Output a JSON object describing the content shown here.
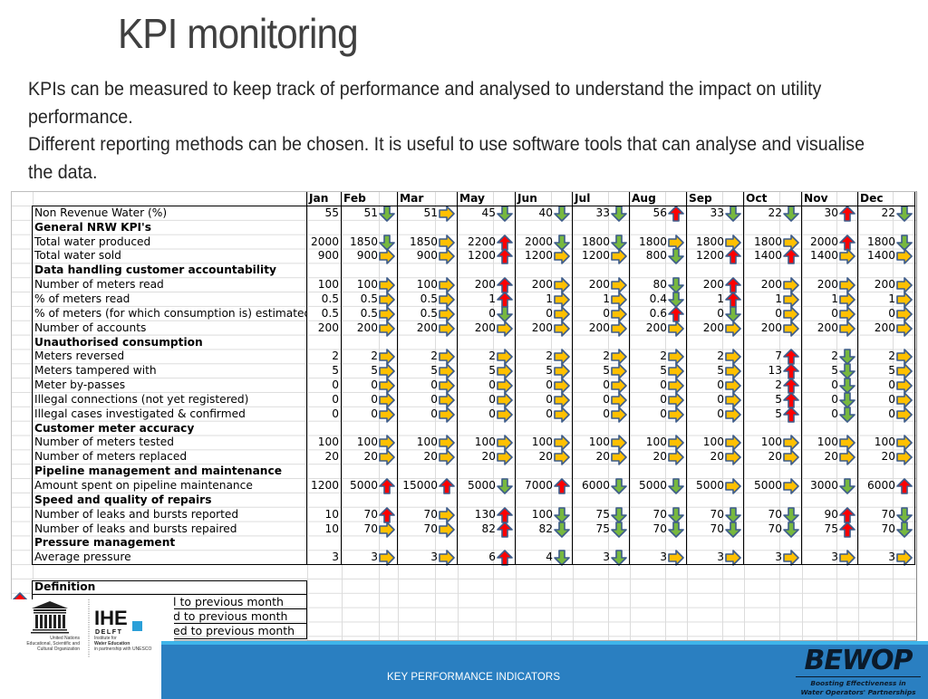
{
  "slide": {
    "title": "KPI monitoring",
    "intro": [
      "KPIs can be measured to keep track of performance and analysed to understand the impact on utility performance.",
      "Different reporting methods can be chosen. It is useful to use software tools that can analyse and visualise the data."
    ],
    "footer_label": "KEY PERFORMANCE INDICATORS"
  },
  "logos": {
    "unesco": {
      "name": "UNESCO",
      "caption": [
        "United Nations",
        "Educational, Scientific and",
        "Cultural Organization"
      ]
    },
    "ihe": {
      "name": "IHE",
      "sub": "DELFT",
      "caption": [
        "Institute for",
        "Water Education",
        "in partnership with UNESCO"
      ]
    },
    "bewop": {
      "name": "BEWOP",
      "tagline": [
        "Boosting Effectiveness in",
        "Water Operators' Partnerships"
      ]
    }
  },
  "colors": {
    "arrow_up": "#ff0000",
    "arrow_down": "#77b83f",
    "arrow_same": "#ffc000",
    "arrow_outline": "#3d5c8a",
    "footer_blue": "#2a7fc1",
    "footer_stripe": "#3fb5ea"
  },
  "kpi_table": {
    "months": [
      "Jan",
      "Feb",
      "Mar",
      "May",
      "Jun",
      "Jul",
      "Aug",
      "Sep",
      "Oct",
      "Nov",
      "Dec"
    ],
    "rows": [
      {
        "type": "kpi",
        "label": "Non Revenue Water (%)",
        "values": [
          "55",
          "51",
          "51",
          "45",
          "40",
          "33",
          "56",
          "33",
          "22",
          "30",
          "22"
        ],
        "trend": [
          "",
          "down",
          "same",
          "down",
          "down",
          "down",
          "up",
          "down",
          "down",
          "up",
          "down"
        ]
      },
      {
        "type": "section",
        "label": "General NRW KPI's"
      },
      {
        "type": "kpi",
        "label": "Total water produced",
        "values": [
          "2000",
          "1850",
          "1850",
          "2200",
          "2000",
          "1800",
          "1800",
          "1800",
          "1800",
          "2000",
          "1800"
        ],
        "trend": [
          "",
          "down",
          "same",
          "up",
          "down",
          "down",
          "same",
          "same",
          "same",
          "up",
          "down"
        ]
      },
      {
        "type": "kpi",
        "label": "Total water sold",
        "values": [
          "900",
          "900",
          "900",
          "1200",
          "1200",
          "1200",
          "800",
          "1200",
          "1400",
          "1400",
          "1400"
        ],
        "trend": [
          "",
          "same",
          "same",
          "up",
          "same",
          "same",
          "down",
          "up",
          "up",
          "same",
          "same"
        ]
      },
      {
        "type": "section",
        "label": "Data handling customer accountability"
      },
      {
        "type": "kpi",
        "label": "Number of meters read",
        "values": [
          "100",
          "100",
          "100",
          "200",
          "200",
          "200",
          "80",
          "200",
          "200",
          "200",
          "200"
        ],
        "trend": [
          "",
          "same",
          "same",
          "up",
          "same",
          "same",
          "down",
          "up",
          "same",
          "same",
          "same"
        ]
      },
      {
        "type": "kpi",
        "label": "% of meters read",
        "values": [
          "0.5",
          "0.5",
          "0.5",
          "1",
          "1",
          "1",
          "0.4",
          "1",
          "1",
          "1",
          "1"
        ],
        "trend": [
          "",
          "same",
          "same",
          "up",
          "same",
          "same",
          "down",
          "up",
          "same",
          "same",
          "same"
        ]
      },
      {
        "type": "kpi",
        "label": "% of meters (for which consumption is) estimated",
        "values": [
          "0.5",
          "0.5",
          "0.5",
          "0",
          "0",
          "0",
          "0.6",
          "0",
          "0",
          "0",
          "0"
        ],
        "trend": [
          "",
          "same",
          "same",
          "down",
          "same",
          "same",
          "up",
          "down",
          "same",
          "same",
          "same"
        ]
      },
      {
        "type": "kpi",
        "label": "Number of accounts",
        "values": [
          "200",
          "200",
          "200",
          "200",
          "200",
          "200",
          "200",
          "200",
          "200",
          "200",
          "200"
        ],
        "trend": [
          "",
          "same",
          "same",
          "same",
          "same",
          "same",
          "same",
          "same",
          "same",
          "same",
          "same"
        ]
      },
      {
        "type": "section",
        "label": "Unauthorised consumption"
      },
      {
        "type": "kpi",
        "label": "Meters reversed",
        "values": [
          "2",
          "2",
          "2",
          "2",
          "2",
          "2",
          "2",
          "2",
          "7",
          "2",
          "2"
        ],
        "trend": [
          "",
          "same",
          "same",
          "same",
          "same",
          "same",
          "same",
          "same",
          "up",
          "down",
          "same"
        ]
      },
      {
        "type": "kpi",
        "label": "Meters tampered with",
        "values": [
          "5",
          "5",
          "5",
          "5",
          "5",
          "5",
          "5",
          "5",
          "13",
          "5",
          "5"
        ],
        "trend": [
          "",
          "same",
          "same",
          "same",
          "same",
          "same",
          "same",
          "same",
          "up",
          "down",
          "same"
        ]
      },
      {
        "type": "kpi",
        "label": "Meter by-passes",
        "values": [
          "0",
          "0",
          "0",
          "0",
          "0",
          "0",
          "0",
          "0",
          "2",
          "0",
          "0"
        ],
        "trend": [
          "",
          "same",
          "same",
          "same",
          "same",
          "same",
          "same",
          "same",
          "up",
          "down",
          "same"
        ]
      },
      {
        "type": "kpi",
        "label": "Illegal connections (not yet registered)",
        "values": [
          "0",
          "0",
          "0",
          "0",
          "0",
          "0",
          "0",
          "0",
          "5",
          "0",
          "0"
        ],
        "trend": [
          "",
          "same",
          "same",
          "same",
          "same",
          "same",
          "same",
          "same",
          "up",
          "down",
          "same"
        ]
      },
      {
        "type": "kpi",
        "label": "Illegal cases investigated & confirmed",
        "values": [
          "0",
          "0",
          "0",
          "0",
          "0",
          "0",
          "0",
          "0",
          "5",
          "0",
          "0"
        ],
        "trend": [
          "",
          "same",
          "same",
          "same",
          "same",
          "same",
          "same",
          "same",
          "up",
          "down",
          "same"
        ]
      },
      {
        "type": "section",
        "label": "Customer meter accuracy"
      },
      {
        "type": "kpi",
        "label": "Number of meters tested",
        "values": [
          "100",
          "100",
          "100",
          "100",
          "100",
          "100",
          "100",
          "100",
          "100",
          "100",
          "100"
        ],
        "trend": [
          "",
          "same",
          "same",
          "same",
          "same",
          "same",
          "same",
          "same",
          "same",
          "same",
          "same"
        ]
      },
      {
        "type": "kpi",
        "label": "Number of meters replaced",
        "values": [
          "20",
          "20",
          "20",
          "20",
          "20",
          "20",
          "20",
          "20",
          "20",
          "20",
          "20"
        ],
        "trend": [
          "",
          "same",
          "same",
          "same",
          "same",
          "same",
          "same",
          "same",
          "same",
          "same",
          "same"
        ]
      },
      {
        "type": "section",
        "label": "Pipeline management and maintenance"
      },
      {
        "type": "kpi",
        "label": "Amount spent on pipeline maintenance",
        "values": [
          "1200",
          "5000",
          "15000",
          "5000",
          "7000",
          "6000",
          "5000",
          "5000",
          "5000",
          "3000",
          "6000"
        ],
        "trend": [
          "",
          "up",
          "up",
          "down",
          "up",
          "down",
          "down",
          "same",
          "same",
          "down",
          "up"
        ]
      },
      {
        "type": "section",
        "label": "Speed and quality of repairs"
      },
      {
        "type": "kpi",
        "label": "Number of leaks and bursts reported",
        "values": [
          "10",
          "70",
          "70",
          "130",
          "100",
          "75",
          "70",
          "70",
          "70",
          "90",
          "70"
        ],
        "trend": [
          "",
          "up",
          "same",
          "up",
          "down",
          "down",
          "down",
          "down",
          "down",
          "up",
          "down"
        ]
      },
      {
        "type": "kpi",
        "label": "Number of leaks and bursts repaired",
        "values": [
          "10",
          "70",
          "70",
          "82",
          "82",
          "75",
          "70",
          "70",
          "70",
          "75",
          "70"
        ],
        "trend": [
          "",
          "same",
          "same",
          "up",
          "down",
          "down",
          "down",
          "down",
          "down",
          "up",
          "down"
        ]
      },
      {
        "type": "section",
        "label": "Pressure management"
      },
      {
        "type": "kpi",
        "label": "Average pressure",
        "values": [
          "3",
          "3",
          "3",
          "6",
          "4",
          "3",
          "3",
          "3",
          "3",
          "3",
          "3"
        ],
        "trend": [
          "",
          "same",
          "same",
          "up",
          "down",
          "down",
          "same",
          "same",
          "same",
          "same",
          "same"
        ]
      }
    ]
  },
  "definition": {
    "header": "Definition",
    "items": [
      {
        "icon": "up",
        "text": "l to previous month"
      },
      {
        "icon": "down",
        "text": "d to previous month"
      },
      {
        "icon": "same",
        "text": "ed to previous month"
      }
    ]
  }
}
